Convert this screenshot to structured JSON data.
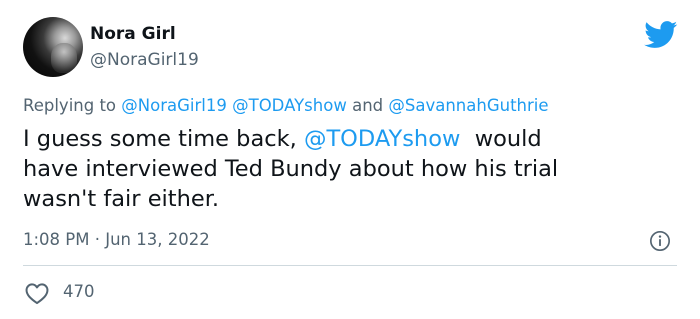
{
  "user": {
    "display_name": "Nora Girl",
    "handle": "@NoraGirl19"
  },
  "reply": {
    "prefix": "Replying to",
    "mention1": "@NoraGirl19",
    "mention2": "@TODAYshow",
    "conjunction": "and",
    "mention3": "@SavannahGuthrie"
  },
  "body": {
    "line1_start": "I guess some time back,",
    "line1_mention": "@TODAYshow",
    "line1_end": "would",
    "line2": "have interviewed Ted Bundy about how his trial",
    "line3": "wasn't fair either."
  },
  "meta": {
    "time": "1:08 PM",
    "separator": "·",
    "date": "Jun 13, 2022"
  },
  "stats": {
    "likes": "470"
  },
  "colors": {
    "accent": "#1d9bf0",
    "secondary_text": "#536471",
    "primary_text": "#0f1419",
    "divider": "#cfd9de"
  },
  "icons": {
    "platform": "twitter-bird-icon",
    "info": "info-icon",
    "like": "heart-icon"
  }
}
